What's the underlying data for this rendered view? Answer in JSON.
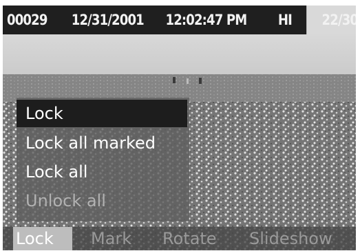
{
  "status_bar": {
    "image_number": "00029",
    "date": "12/31/2001",
    "time": "12:02:47 PM",
    "quality": "HI",
    "frame_counter": "22/30"
  },
  "photo": {
    "subject": "meadow-landscape-photo"
  },
  "menu": {
    "items": [
      {
        "label": "Lock",
        "state": "selected"
      },
      {
        "label": "Lock all marked",
        "state": "normal"
      },
      {
        "label": "Lock all",
        "state": "normal"
      },
      {
        "label": "Unlock all",
        "state": "disabled"
      }
    ]
  },
  "tabs": [
    {
      "label": "Lock",
      "active": true
    },
    {
      "label": "Mark",
      "active": false
    },
    {
      "label": "Rotate",
      "active": false
    },
    {
      "label": "Slideshow",
      "active": false
    }
  ],
  "colors": {
    "status_bar_bg": "#1f1f1f",
    "selected_item_bg": "#1d1d1d",
    "active_tab_bg": "#bdbdbd",
    "inactive_text": "#9a9a9a"
  }
}
